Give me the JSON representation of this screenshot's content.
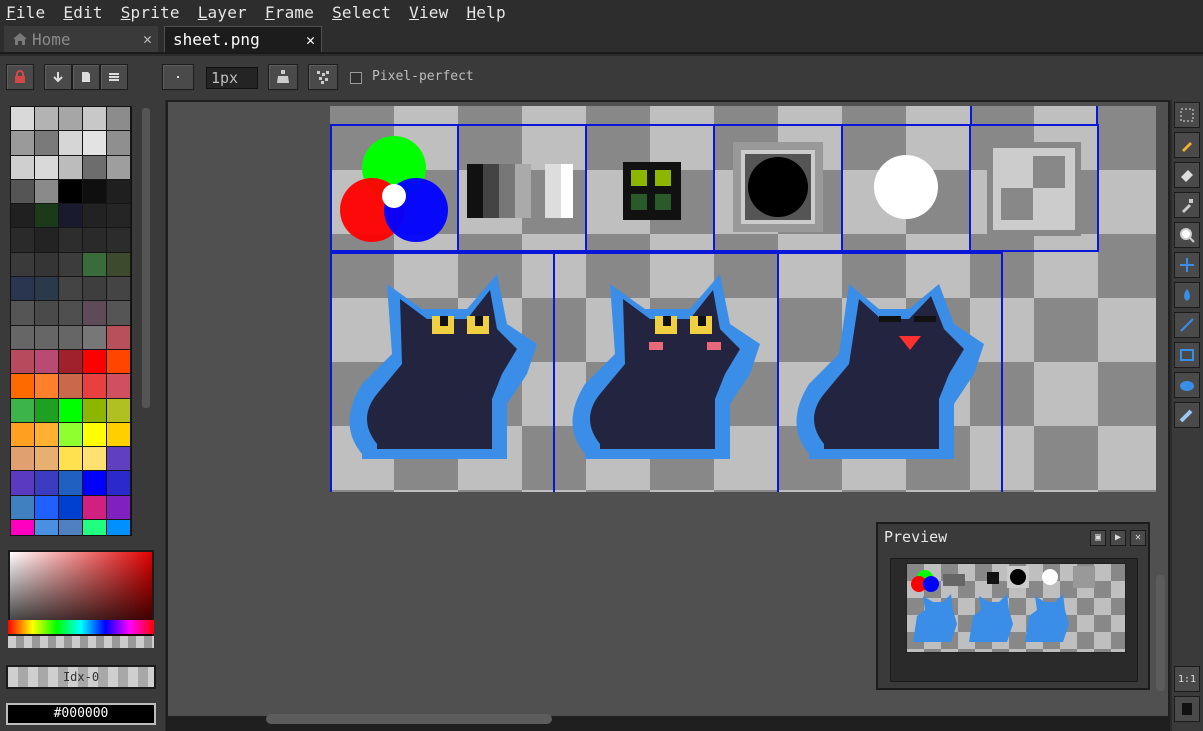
{
  "menu": [
    "File",
    "Edit",
    "Sprite",
    "Layer",
    "Frame",
    "Select",
    "View",
    "Help"
  ],
  "tabs": {
    "home": "Home",
    "sheet": "sheet.png",
    "close": "✕"
  },
  "toolbar": {
    "brush_size": "1px",
    "pixel_perfect_label": "Pixel-perfect"
  },
  "palette_colors": [
    "#d9d9d9",
    "#b3b3b3",
    "#a6a6a6",
    "#c8c8c8",
    "#8c8c8c",
    "#9a9a9a",
    "#7a7a7a",
    "#d6d6d6",
    "#e3e3e3",
    "#8f8f8f",
    "#cfcfcf",
    "#d9d9d9",
    "#bcbcbc",
    "#6d6d6d",
    "#9e9e9e",
    "#555555",
    "#8a8a8a",
    "#000000",
    "#0f0f0f",
    "#1f1f1f",
    "#202020",
    "#1a3a1a",
    "#1a1a2e",
    "#222222",
    "#252525",
    "#2a2a2a",
    "#232323",
    "#2d2d2d",
    "#2a2a2a",
    "#2c2c2c",
    "#3a3a3a",
    "#353535",
    "#3c3c3c",
    "#3a6b3a",
    "#3d4a2e",
    "#2a3550",
    "#2a3a4a",
    "#444444",
    "#3e3e3e",
    "#444444",
    "#555555",
    "#4a4a4a",
    "#4f4f4f",
    "#5e4b57",
    "#555555",
    "#666666",
    "#666666",
    "#666666",
    "#777777",
    "#b8505a",
    "#b84a5e",
    "#b84a74",
    "#a0202c",
    "#ff0000",
    "#ff4500",
    "#ff6a00",
    "#ff7f2a",
    "#c86a4a",
    "#e84040",
    "#d05060",
    "#3cb44a",
    "#20a020",
    "#00ff00",
    "#8db600",
    "#b0c020",
    "#ffa020",
    "#ffb030",
    "#90ff30",
    "#ffff00",
    "#ffd000",
    "#e0a070",
    "#e8b070",
    "#ffe050",
    "#ffe070",
    "#6040c0",
    "#5a3ac0",
    "#3c3cc0",
    "#2060c0",
    "#0000ff",
    "#2a2acc",
    "#4080c0",
    "#2060ff",
    "#0040d0",
    "#d02080",
    "#8020c0",
    "#ff00c0",
    "#4a90e0",
    "#5080c0",
    "#20ff80",
    "#0090ff"
  ],
  "color": {
    "index_label": "Idx-0",
    "hex": "#000000"
  },
  "preview": {
    "title": "Preview"
  },
  "tools": {
    "ratio_label": "1:1"
  }
}
